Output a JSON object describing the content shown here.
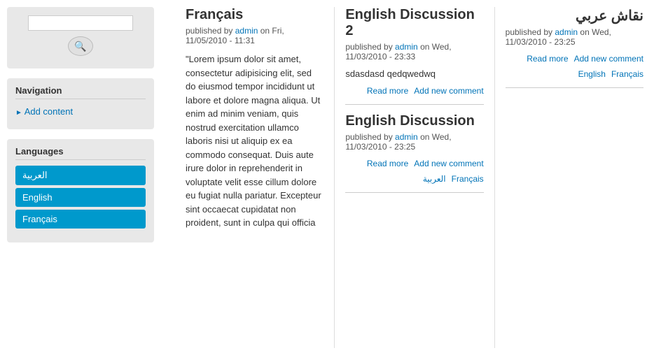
{
  "sidebar": {
    "search": {
      "placeholder": "",
      "button_icon": "🔍"
    },
    "navigation": {
      "title": "Navigation",
      "items": [
        {
          "label": "Add content",
          "id": "add-content"
        }
      ]
    },
    "languages": {
      "title": "Languages",
      "buttons": [
        {
          "label": "العربية",
          "id": "arabic",
          "class": "lang-arabic"
        },
        {
          "label": "English",
          "id": "english",
          "class": "lang-english"
        },
        {
          "label": "Français",
          "id": "francais",
          "class": "lang-francais"
        }
      ]
    }
  },
  "columns": [
    {
      "id": "francais-col",
      "articles": [
        {
          "id": "article-francais",
          "title": "Français",
          "meta_prefix": "published by ",
          "author": "admin",
          "meta_suffix": " on Fri, 11/05/2010 - 11:31",
          "body": "\"Lorem ipsum dolor sit amet, consectetur adipisicing elit, sed do eiusmod tempor incididunt ut labore et dolore magna aliqua. Ut enim ad minim veniam, quis nostrud exercitation ullamco laboris nisi ut aliquip ex ea commodo consequat. Duis aute irure dolor in reprehenderit in voluptate velit esse cillum dolore eu fugiat nulla pariatur. Excepteur sint occaecat cupidatat non proident, sunt in culpa qui officia",
          "links": []
        }
      ]
    },
    {
      "id": "english-col",
      "articles": [
        {
          "id": "article-english-discussion-2",
          "title": "English Discussion 2",
          "meta_prefix": "published by ",
          "author": "admin",
          "meta_suffix": " on Wed, 11/03/2010 - 23:33",
          "excerpt": "sdasdasd qedqwedwq",
          "links": [
            {
              "label": "Read more",
              "id": "read-more-ed2"
            },
            {
              "label": "Add new comment",
              "id": "add-comment-ed2"
            }
          ]
        },
        {
          "id": "article-english-discussion",
          "title": "English Discussion",
          "meta_prefix": "published by ",
          "author": "admin",
          "meta_suffix": " on Wed, 11/03/2010 - 23:25",
          "excerpt": "",
          "links": [
            {
              "label": "Read more",
              "id": "read-more-ed"
            },
            {
              "label": "Add new comment",
              "id": "add-comment-ed"
            },
            {
              "label": "العربية",
              "id": "lang-arabic-ed"
            },
            {
              "label": "Français",
              "id": "lang-francais-ed"
            }
          ]
        }
      ]
    },
    {
      "id": "arabic-col",
      "articles": [
        {
          "id": "article-arabic-discussion",
          "title": "نقاش عربي",
          "meta_prefix": "published by ",
          "author": "admin",
          "meta_suffix": " on Wed, 11/03/2010 - 23:25",
          "excerpt": "",
          "links": [
            {
              "label": "Read more",
              "id": "read-more-ad"
            },
            {
              "label": "Add new comment",
              "id": "add-comment-ad"
            },
            {
              "label": "English",
              "id": "lang-english-ad"
            },
            {
              "label": "Français",
              "id": "lang-francais-ad"
            }
          ]
        }
      ]
    }
  ]
}
